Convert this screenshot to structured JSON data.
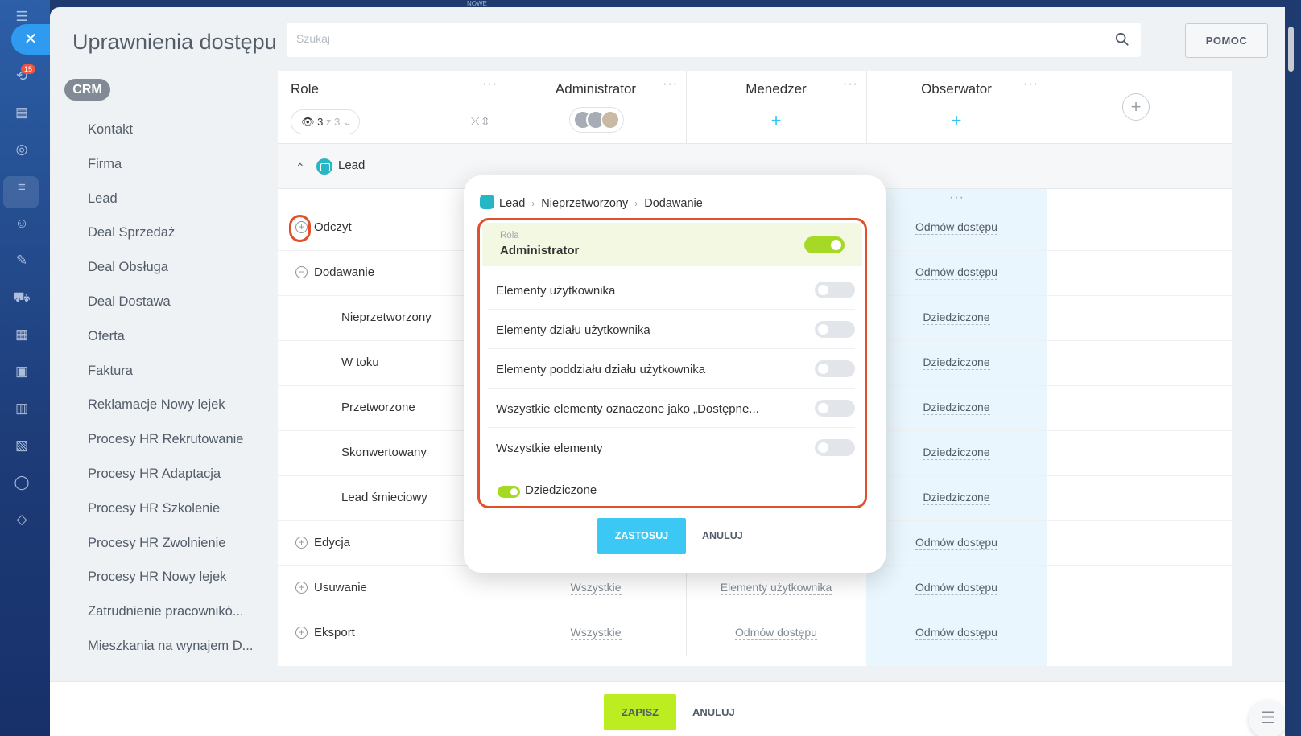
{
  "rail": {
    "badge": "15"
  },
  "header": {
    "title": "Uprawnienia dostępu",
    "search_placeholder": "Szukaj",
    "help_label": "POMOC",
    "top_tag": "NOWE"
  },
  "sidebar": {
    "section": "CRM",
    "items": [
      "Kontakt",
      "Firma",
      "Lead",
      "Deal Sprzedaż",
      "Deal Obsługa",
      "Deal Dostawa",
      "Oferta",
      "Faktura",
      "Reklamacje Nowy lejek",
      "Procesy HR Rekrutowanie",
      "Procesy HR Adaptacja",
      "Procesy HR Szkolenie",
      "Procesy HR Zwolnienie",
      "Procesy HR Nowy lejek",
      "Zatrudnienie pracownikó...",
      "Mieszkania na wynajem D..."
    ]
  },
  "table": {
    "roles_header": "Role",
    "filter": {
      "count": "3",
      "of": "z 3"
    },
    "columns": [
      "Administrator",
      "Menedżer",
      "Obserwator"
    ],
    "section": "Lead",
    "rows": [
      {
        "name": "Odczyt",
        "observer": "Odmów dostępu"
      },
      {
        "name": "Dodawanie",
        "observer": "Odmów dostępu"
      },
      {
        "name": "Nieprzetworzony",
        "observer": "Dziedziczone"
      },
      {
        "name": "W toku",
        "observer": "Dziedziczone"
      },
      {
        "name": "Przetworzone",
        "observer": "Dziedziczone"
      },
      {
        "name": "Skonwertowany",
        "observer": "Dziedziczone"
      },
      {
        "name": "Lead śmieciowy",
        "observer": "Dziedziczone"
      },
      {
        "name": "Edycja",
        "observer": "Odmów dostępu"
      },
      {
        "name": "Usuwanie",
        "admin": "Wszystkie",
        "manager": "Elementy użytkownika",
        "observer": "Odmów dostępu"
      },
      {
        "name": "Eksport",
        "admin": "Wszystkie",
        "manager": "Odmów dostępu",
        "observer": "Odmów dostępu"
      }
    ]
  },
  "popup": {
    "breadcrumb": [
      "Lead",
      "Nieprzetworzony",
      "Dodawanie"
    ],
    "role_caption": "Rola",
    "role_value": "Administrator",
    "options": [
      "Elementy użytkownika",
      "Elementy działu użytkownika",
      "Elementy poddziału działu użytkownika",
      "Wszystkie elementy oznaczone jako „Dostępne...",
      "Wszystkie elementy"
    ],
    "inherit_label": "Dziedziczone",
    "apply_label": "ZASTOSUJ",
    "cancel_label": "ANULUJ"
  },
  "footer": {
    "save_label": "ZAPISZ",
    "cancel_label": "ANULUJ"
  },
  "colors": {
    "accent": "#3bc8f5",
    "save": "#bbed21",
    "highlight": "#e0502a",
    "toggle_on": "#a6d826"
  }
}
